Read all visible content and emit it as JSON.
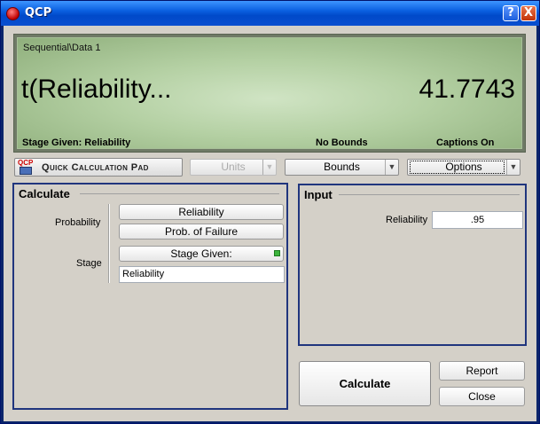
{
  "window": {
    "title": "QCP",
    "help_button": "?",
    "close_button": "X"
  },
  "display": {
    "path": "Sequential\\Data 1",
    "function": "t(Reliability...",
    "value": "41.7743",
    "stage_given": "Stage Given: Reliability",
    "bounds": "No Bounds",
    "captions": "Captions On"
  },
  "toolbar": {
    "qcp_logo": "QCP",
    "quick_calc_pad": "Quick Calculation Pad",
    "units": "Units",
    "bounds": "Bounds",
    "options": "Options"
  },
  "calculate": {
    "title": "Calculate",
    "probability_label": "Probability",
    "reliability_button": "Reliability",
    "prob_failure_button": "Prob. of Failure",
    "stage_label": "Stage",
    "stage_given_button": "Stage Given:",
    "stage_value": "Reliability"
  },
  "input": {
    "title": "Input",
    "reliability_label": "Reliability",
    "reliability_value": ".95"
  },
  "actions": {
    "calculate": "Calculate",
    "report": "Report",
    "close": "Close"
  }
}
